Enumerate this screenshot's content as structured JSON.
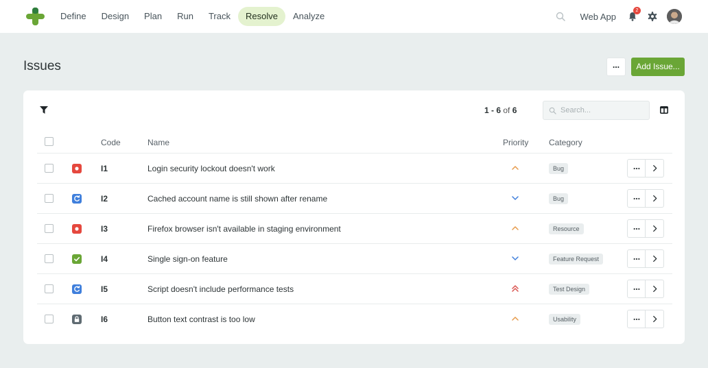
{
  "nav": {
    "items": [
      {
        "label": "Define",
        "active": false
      },
      {
        "label": "Design",
        "active": false
      },
      {
        "label": "Plan",
        "active": false
      },
      {
        "label": "Run",
        "active": false
      },
      {
        "label": "Track",
        "active": false
      },
      {
        "label": "Resolve",
        "active": true
      },
      {
        "label": "Analyze",
        "active": false
      }
    ],
    "project": "Web App",
    "notifications": "2"
  },
  "page": {
    "title": "Issues",
    "add_label": "Add Issue..."
  },
  "toolbar": {
    "range": "1 - 6",
    "of": "of",
    "total": "6",
    "search_placeholder": "Search..."
  },
  "table": {
    "headers": {
      "code": "Code",
      "name": "Name",
      "priority": "Priority",
      "category": "Category"
    },
    "rows": [
      {
        "code": "I1",
        "name": "Login security lockout doesn't work",
        "status": "open",
        "priority": "high",
        "category": "Bug"
      },
      {
        "code": "I2",
        "name": "Cached account name is still shown after rename",
        "status": "in-progress",
        "priority": "low",
        "category": "Bug"
      },
      {
        "code": "I3",
        "name": "Firefox browser isn't available in staging environment",
        "status": "open",
        "priority": "high",
        "category": "Resource"
      },
      {
        "code": "I4",
        "name": "Single sign-on feature",
        "status": "resolved",
        "priority": "low",
        "category": "Feature Request"
      },
      {
        "code": "I5",
        "name": "Script doesn't include performance tests",
        "status": "in-progress",
        "priority": "critical",
        "category": "Test Design"
      },
      {
        "code": "I6",
        "name": "Button text contrast is too low",
        "status": "closed",
        "priority": "high",
        "category": "Usability"
      }
    ]
  },
  "colors": {
    "brand": "#6aa636",
    "open": "#e5483e",
    "in_progress": "#3f7fdc",
    "resolved": "#6aa636",
    "closed": "#5f6b72",
    "priority_high": "#e69a4a",
    "priority_low": "#3f7fdc",
    "priority_critical": "#d9534f"
  }
}
